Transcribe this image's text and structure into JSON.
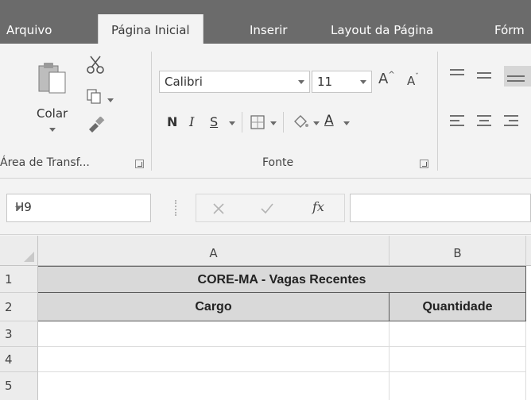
{
  "tabs": [
    "Arquivo",
    "Página Inicial",
    "Inserir",
    "Layout da Página",
    "Fórm"
  ],
  "ribbon": {
    "clipboard": {
      "paste_label": "Colar",
      "group_label": "Área de Transf..."
    },
    "font": {
      "font_name": "Calibri",
      "font_size": "11",
      "grow_label": "A",
      "shrink_label": "A",
      "bold": "N",
      "italic": "I",
      "underline": "S",
      "font_color_letter": "A",
      "group_label": "Fonte"
    }
  },
  "formula_bar": {
    "name_box": "H9",
    "fx": "fx",
    "value": ""
  },
  "sheet": {
    "columns": [
      "A",
      "B"
    ],
    "rows": [
      "1",
      "2",
      "3",
      "4",
      "5"
    ],
    "cells": {
      "merged_title": "CORE-MA - Vagas Recentes",
      "a2": "Cargo",
      "b2": "Quantidade"
    }
  }
}
